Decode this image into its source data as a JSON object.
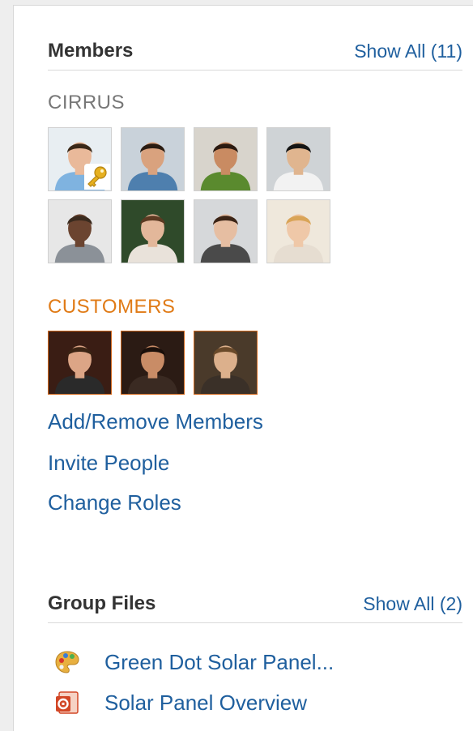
{
  "members": {
    "title": "Members",
    "show_all_label": "Show All (11)",
    "groups": [
      {
        "label": "CIRRUS",
        "color": "#777777",
        "avatars": [
          {
            "name": "owner",
            "bg": "#e8eef2",
            "skin": "#e9b99a",
            "hair": "#3a2818",
            "shirt": "#7fb3e0",
            "owner": true
          },
          {
            "name": "member-2",
            "bg": "#c9d2da",
            "skin": "#d9a27e",
            "hair": "#2a1c12",
            "shirt": "#4e7fae"
          },
          {
            "name": "member-3",
            "bg": "#d8d4cc",
            "skin": "#c98b62",
            "hair": "#2b1a10",
            "shirt": "#5a8a2e"
          },
          {
            "name": "member-4",
            "bg": "#cfd3d6",
            "skin": "#e0b58f",
            "hair": "#141414",
            "shirt": "#f2f2f2"
          },
          {
            "name": "member-5",
            "bg": "#e7e7e7",
            "skin": "#6b4430",
            "hair": "#3a2a1e",
            "shirt": "#8b9198"
          },
          {
            "name": "member-6",
            "bg": "#2f4a2a",
            "skin": "#e3b79a",
            "hair": "#5c3a22",
            "shirt": "#e9e2da"
          },
          {
            "name": "member-7",
            "bg": "#d6d8da",
            "skin": "#e6bea2",
            "hair": "#3b2416",
            "shirt": "#4a4a4a"
          },
          {
            "name": "member-8",
            "bg": "#efe8dc",
            "skin": "#efc8a8",
            "hair": "#d9a457",
            "shirt": "#e6ddd1"
          }
        ]
      },
      {
        "label": "CUSTOMERS",
        "color": "#e07b17",
        "avatars": [
          {
            "name": "customer-1",
            "bg": "#3a1d14",
            "skin": "#dca586",
            "hair": "#3b2414",
            "shirt": "#2a2a2a"
          },
          {
            "name": "customer-2",
            "bg": "#2b1b14",
            "skin": "#c98c66",
            "hair": "#1a0f0a",
            "shirt": "#3a2a22"
          },
          {
            "name": "customer-3",
            "bg": "#4a3a2a",
            "skin": "#dcb08c",
            "hair": "#6a4a2a",
            "shirt": "#3a3028"
          }
        ]
      }
    ],
    "actions": [
      "Add/Remove Members",
      "Invite People",
      "Change Roles"
    ]
  },
  "files": {
    "title": "Group Files",
    "show_all_label": "Show All (2)",
    "items": [
      {
        "label": "Green Dot Solar Panel...",
        "icon": "palette-icon"
      },
      {
        "label": "Solar Panel Overview",
        "icon": "presentation-icon"
      }
    ]
  },
  "colors": {
    "link": "#1f5f9e",
    "customers_accent": "#e07b17",
    "group_gray": "#777777"
  }
}
